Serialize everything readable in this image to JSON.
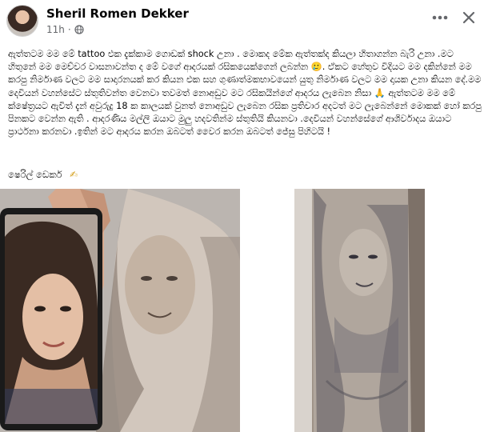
{
  "post": {
    "author": "Sheril Romen Dekker",
    "time": "11h",
    "privacy_icon": "globe-icon",
    "more_icon": "more-horizontal-icon",
    "close_icon": "close-icon",
    "body": "ඇත්තටම මම මේ tattoo එක දැක්කාම ගොඩක් shock උනා . මොකද මේක ඇත්තක්ද කියලා හිතාගන්න බැරි උනා .මට හිතුනේ මම මෙච්චර වාසනාවන්ත ද මේ වගේ ආදරයක් රසිකයෙක්ගෙන් ලබන්න 🥲. ඒකට හේතුව විදියට මම දකින්නේ මම කරපු නිර්මාණ වලට මම සාදාරනයක් කර කියන එක සහ ගුණාත්මකභාවයෙන් යුතු නිර්මාණ වලට මම දායක උනා කියන දේ.මම දෙවියන් වහන්සේට ස්තුතිවන්ත වෙනවා තවමත් නොඅඩුව මට රසිකයින්ගේ ආදරය ලැබෙන නිසා 🙏 ඇත්තටම මම මේ ක්ෂේත්‍රයට ඇවිත් දැන් අවුරුදු 18 ක කාලයක් වුනත් නොඅඩුව ලැබෙන රසික ප්‍රතිචාර අදටත් මට ලැබෙන්නේ මොකක් හෝ කරපු පිනකට වෙන්න ඇති . ආදරණිය මල්ලි ඔයාට මුලු හදවතින්ම ස්තුතියි කියනවා .දෙවියන් වහන්සේගේ ආශිර්වාදය ඔයාට ප්‍රාර්ථනා කරනවා .ඉතින් මට ආදරය කරන ඔබටත් වෛර කරන ඔබටත් ජේසු පිහිටයි !",
    "signature": "ෂෙරිල් ඩෙකර්",
    "signature_emoji": "✍"
  },
  "colors": {
    "text": "#050505",
    "secondary_text": "#65676b",
    "background": "#ffffff"
  }
}
